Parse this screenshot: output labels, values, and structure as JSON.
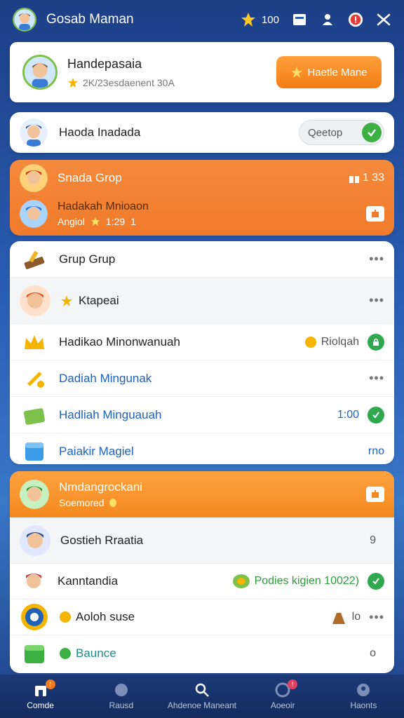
{
  "topbar": {
    "title": "Gosab Maman",
    "coins": "100",
    "icons": [
      "star-icon",
      "inbox-icon",
      "people-icon",
      "alert-icon",
      "shuffle-icon"
    ]
  },
  "profile": {
    "name": "Handepasaia",
    "sub": "2K/23esdaenent 30A",
    "button_label": "Haetle Mane"
  },
  "group": {
    "name": "Haoda Inadada",
    "search_placeholder": "Qeetop"
  },
  "orange_card": {
    "title": "Snada Grop",
    "count": "1 33",
    "line1": "Hadakah Mnioaon",
    "line2_a": "Angiol",
    "line2_b": "1:29",
    "line2_c": "1"
  },
  "list": {
    "header": "Grup Grup",
    "row_kapea": "Ktapeai",
    "row3_label": "Hadikao Minonwanuah",
    "row3_value": "Riolqah",
    "row4_label": "Dadiah Mingunak",
    "row5_label": "Hadliah Minguauah",
    "row5_value": "1:00",
    "row6_label": "Paiakir Magiel",
    "row6_value": "rno"
  },
  "bottom_card": {
    "header_title": "Nmdangrockani",
    "header_sub": "Soemored",
    "row1_label": "Gostieh Rraatia",
    "row1_value": "9",
    "row2_label": "Kanntandia",
    "row2_value": "Podies kigien 10022)",
    "row3_label": "Aoloh suse",
    "row3_value": "lo",
    "row4_label": "Baunce",
    "row4_value": "o"
  },
  "nav": {
    "items": [
      "Comde",
      "Rausd",
      "Ahdenoe Maneant",
      "Aoeoir",
      "Haonts"
    ]
  },
  "colors": {
    "accent_orange": "#f27d16",
    "green": "#2fa84f",
    "blue_text": "#1f62b8",
    "nav_bg": "#1c3a78"
  }
}
